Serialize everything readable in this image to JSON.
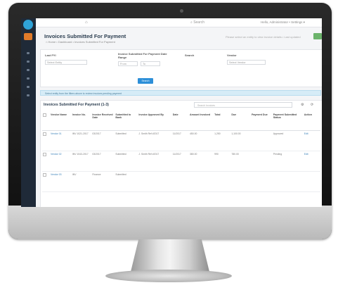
{
  "app": {
    "page_title": "Invoices Submitted For Payment",
    "breadcrumb": "⌂ Home  •  Dashboard  •  Invoices Submitted For Payment",
    "header_info": "Please select an entity to view invoice details  •  Last updated",
    "topbar_search": "⌕ Search",
    "topbar_user": "Hello, Administrator  •  Settings ▾"
  },
  "filters": {
    "label_1": "Last FYI",
    "input_1": "Select Entity",
    "label_2": "Invoice Submitted For Payment Date Range",
    "from_value": "From",
    "to_value": "To",
    "label_3": "Search",
    "label_4": "Vendor",
    "input_4": "Select Vendor",
    "search_button": "Search"
  },
  "info_bar": "Select entity from the filters above to review invoices pending payment",
  "table": {
    "title": "Invoices Submitted For Payment (1-3)",
    "search_placeholder": "Search Invoices",
    "filter_placeholder": "Filter",
    "columns": [
      "",
      "Vendor Name",
      "Invoice No.",
      "Invoice Received Date",
      "Submitted to Bank",
      "Invoice Approved By",
      "Date",
      "Amount Invoiced",
      "Total",
      "Due",
      "Payment Due",
      "Payment Submitted Status",
      "Action"
    ],
    "rows": [
      [
        "",
        "Vendor 01",
        "INV 1021-2017",
        "03/2017",
        "Submitted",
        "J. Smith Ref #2017",
        "11/2017",
        "450.00",
        "1,250",
        "1,100.00",
        "",
        "Approved",
        "Edit"
      ],
      [
        "",
        "Vendor 02",
        "INV 1043-2017",
        "03/2017",
        "Submitted",
        "J. Smith Ref #2017",
        "11/2017",
        "380.00",
        "990",
        "780.00",
        "",
        "Pending",
        "Edit"
      ],
      [
        "",
        "Vendor 03",
        "INV",
        "Finance",
        "Submitted",
        "",
        "",
        "",
        "",
        "",
        "",
        "",
        ""
      ]
    ]
  }
}
